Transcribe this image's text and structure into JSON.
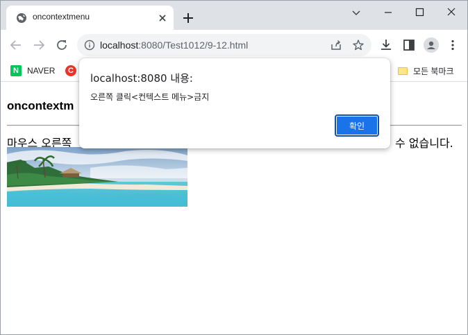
{
  "browser": {
    "tab": {
      "title": "oncontextmenu"
    },
    "address_bar": {
      "host": "localhost",
      "rest": ":8080/Test1012/9-12.html"
    },
    "bookmarks": [
      {
        "label": "NAVER",
        "icon": "naver-icon"
      },
      {
        "label": "",
        "icon": "c-logo-icon"
      }
    ],
    "all_bookmarks_label": "모든 북마크"
  },
  "page": {
    "heading": "oncontextm",
    "paragraph_visible_left": "마우스 오른쪽",
    "paragraph_visible_right": "수 없습니다.",
    "image": {
      "description_icon": "beach-image"
    }
  },
  "dialog": {
    "title": "localhost:8080 내용:",
    "message": "오른쪽 클릭<컨텍스트 메뉴>금지",
    "ok_label": "확인"
  },
  "colors": {
    "tabstrip_bg": "#dee1e6",
    "accent_button": "#1a73e8",
    "naver_green": "#03c75a"
  }
}
